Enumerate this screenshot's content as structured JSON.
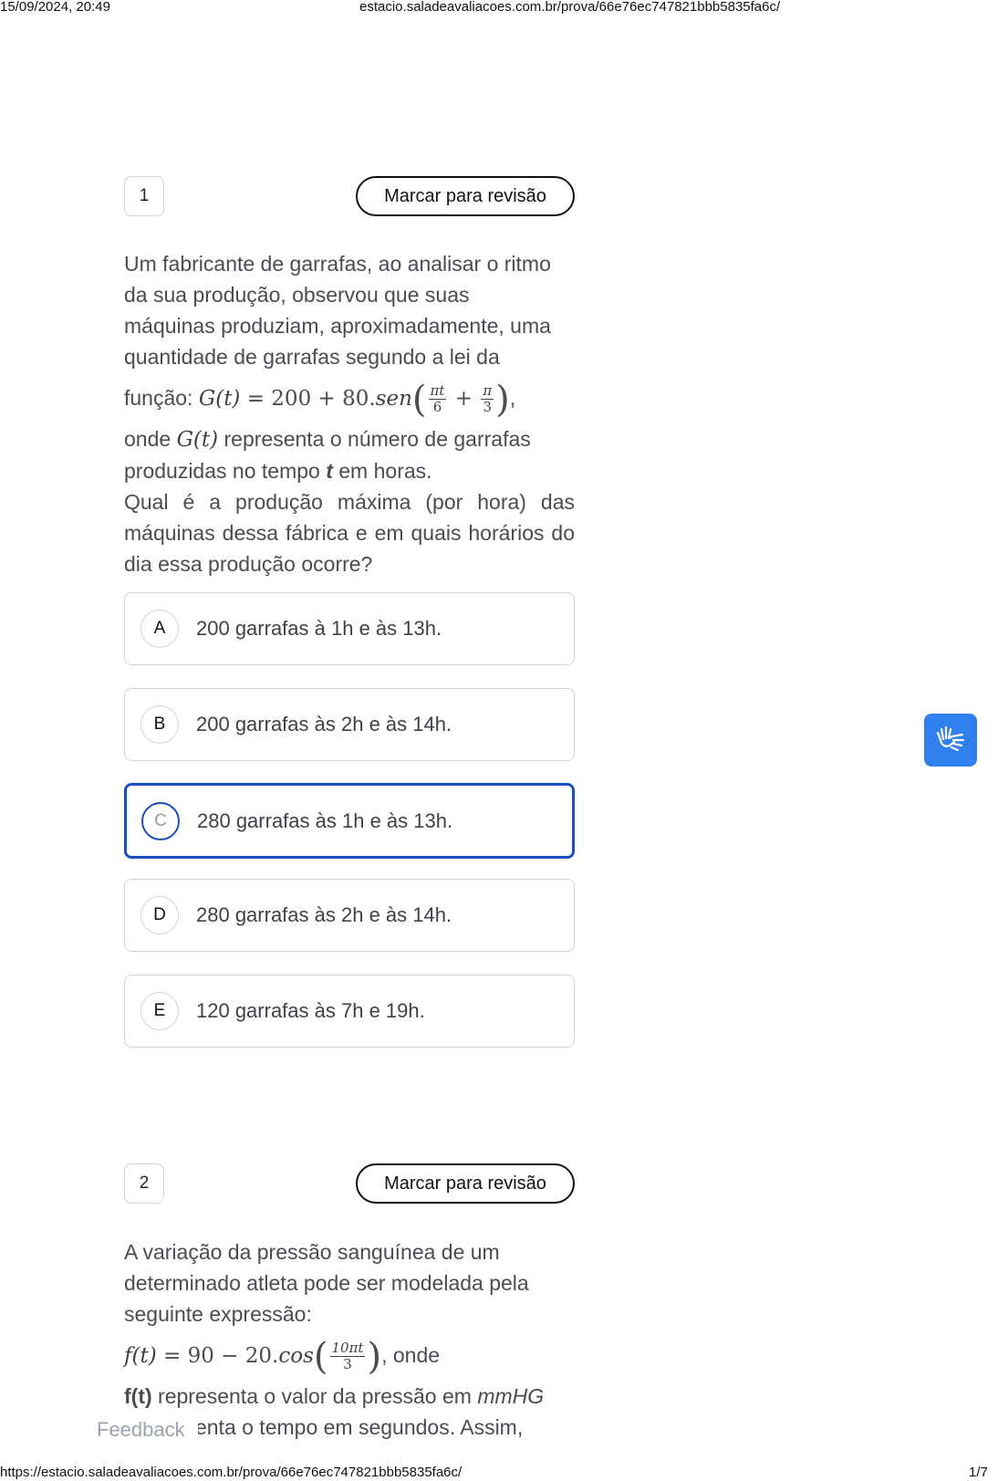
{
  "header": {
    "datetime": "15/09/2024, 20:49",
    "url": "estacio.saladeavaliacoes.com.br/prova/66e76ec747821bbb5835fa6c/"
  },
  "footer": {
    "url": "https://estacio.saladeavaliacoes.com.br/prova/66e76ec747821bbb5835fa6c/",
    "page": "1/7"
  },
  "questions": [
    {
      "number": "1",
      "mark_label": "Marcar para revisão",
      "text_lines": [
        "Um fabricante de garrafas, ao analisar o ritmo",
        "da sua produção, observou que suas",
        "máquinas produziam, aproximadamente, uma",
        "quantidade de garrafas segundo a lei da"
      ],
      "formula_prefix": "função: ",
      "formula": {
        "lhs": "G(t)",
        "eq": " = 200 + 80.",
        "fn": "sen",
        "frac1_num": "πt",
        "frac1_den": "6",
        "plus": " + ",
        "frac2_num": "π",
        "frac2_den": "3",
        "suffix": ","
      },
      "line_after_1": "onde ",
      "line_after_math": "G(t)",
      "line_after_2": " representa o número de garrafas",
      "line_after_3": "produzidas no tempo ",
      "line_after_var": "t",
      "line_after_4": " em horas.",
      "question": "Qual é a produção máxima (por hora) das máquinas dessa fábrica e em quais horários do dia essa produção ocorre?",
      "options": [
        {
          "letter": "A",
          "text": "200 garrafas à 1h e às 13h."
        },
        {
          "letter": "B",
          "text": "200 garrafas às 2h e às 14h."
        },
        {
          "letter": "C",
          "text": "280 garrafas às 1h e às 13h.",
          "selected": true
        },
        {
          "letter": "D",
          "text": "280 garrafas às 2h e às 14h."
        },
        {
          "letter": "E",
          "text": "120 garrafas às 7h e 19h."
        }
      ]
    },
    {
      "number": "2",
      "mark_label": "Marcar para revisão",
      "text_lines": [
        "A variação da pressão sanguínea de um",
        "determinado atleta pode ser modelada pela",
        "seguinte expressão:"
      ],
      "formula": {
        "lhs": "f(t)",
        "eq": " = 90 − 20.",
        "fn": "cos",
        "frac_num": "10πt",
        "frac_den": "3",
        "suffix": ", onde"
      },
      "line_a_bold": "f(t)",
      "line_a_rest": " representa o valor da pressão em ",
      "line_a_unit": "mmHG",
      "line_b": "t representa o tempo em segundos. Assim,"
    }
  ],
  "feedback_label": "Feedback",
  "accessibility_icon": "sign-language-icon",
  "accent_color": "#1a4fbe"
}
